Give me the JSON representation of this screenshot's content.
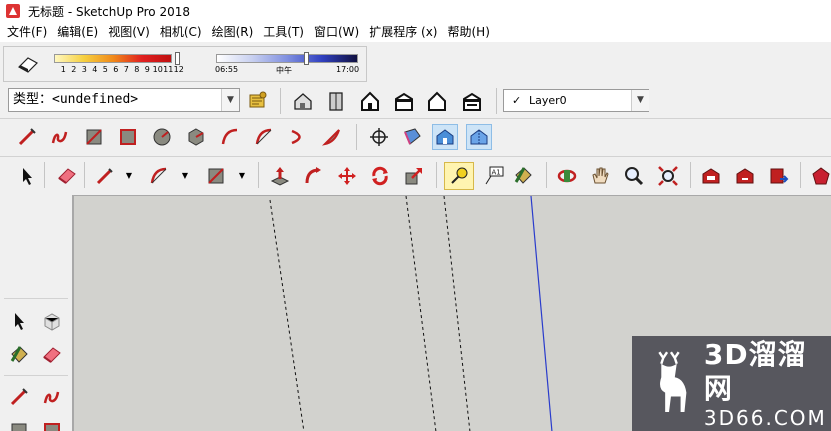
{
  "window": {
    "title": "无标题 - SketchUp Pro 2018"
  },
  "menu": [
    "文件(F)",
    "编辑(E)",
    "视图(V)",
    "相机(C)",
    "绘图(R)",
    "工具(T)",
    "窗口(W)",
    "扩展程序 (x)",
    "帮助(H)"
  ],
  "shadows": {
    "months": [
      "1",
      "2",
      "3",
      "4",
      "5",
      "6",
      "7",
      "8",
      "9",
      "10",
      "11",
      "12"
    ],
    "time_start": "06:55",
    "time_mid": "中午",
    "time_end": "17:00"
  },
  "entity_info": {
    "type_label": "类型：<undefined>"
  },
  "layers": {
    "check": "✓",
    "current": "Layer0"
  },
  "colors": {
    "axis_blue": "#2a3ccc",
    "viewport_bg": "#d2d2ce",
    "selected_bg": "#cde4f7"
  },
  "watermark": {
    "brand": "3D溜溜网",
    "url": "3D66.COM"
  }
}
